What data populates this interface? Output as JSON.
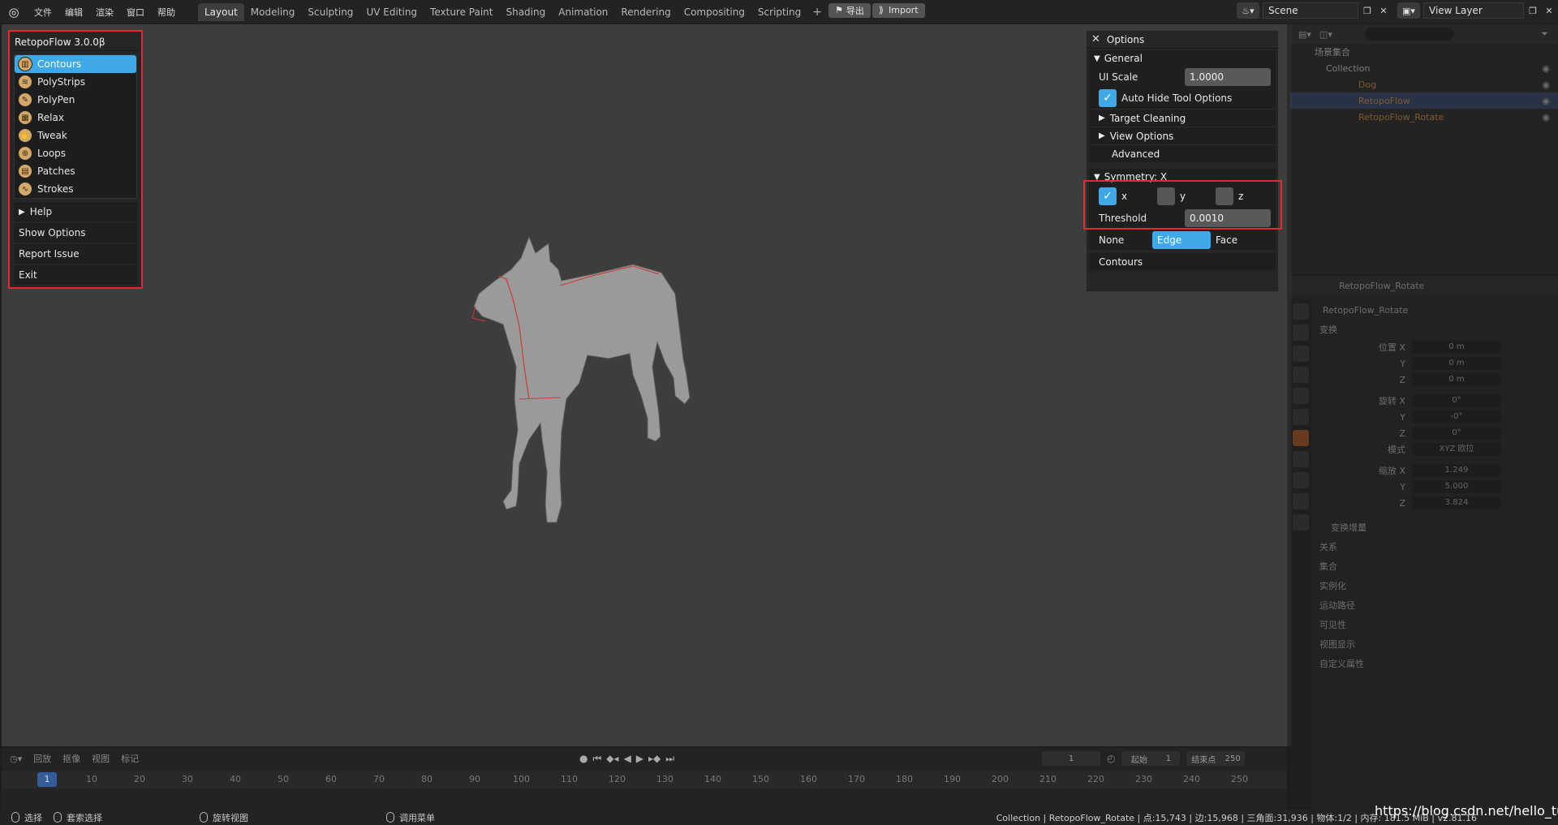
{
  "topbar": {
    "menus": [
      "文件",
      "编辑",
      "渲染",
      "窗口",
      "帮助"
    ],
    "workspaces": [
      "Layout",
      "Modeling",
      "Sculpting",
      "UV Editing",
      "Texture Paint",
      "Shading",
      "Animation",
      "Rendering",
      "Compositing",
      "Scripting"
    ],
    "active_workspace": "Layout",
    "add_tab": "+",
    "export_label": "导出",
    "import_label": "Import",
    "scene_name": "Scene",
    "view_layer": "View Layer"
  },
  "retopoflow": {
    "title": "RetopoFlow 3.0.0β",
    "tools": [
      {
        "label": "Contours",
        "icon": "contours-icon",
        "active": true
      },
      {
        "label": "PolyStrips",
        "icon": "polystrips-icon",
        "active": false
      },
      {
        "label": "PolyPen",
        "icon": "polypen-icon",
        "active": false
      },
      {
        "label": "Relax",
        "icon": "relax-icon",
        "active": false
      },
      {
        "label": "Tweak",
        "icon": "tweak-icon",
        "active": false
      },
      {
        "label": "Loops",
        "icon": "loops-icon",
        "active": false
      },
      {
        "label": "Patches",
        "icon": "patches-icon",
        "active": false
      },
      {
        "label": "Strokes",
        "icon": "strokes-icon",
        "active": false
      }
    ],
    "help": "Help",
    "show_options": "Show Options",
    "report_issue": "Report Issue",
    "exit": "Exit"
  },
  "options": {
    "title": "Options",
    "general": "General",
    "ui_scale_label": "UI Scale",
    "ui_scale_value": "1.0000",
    "auto_hide_label": "Auto Hide Tool Options",
    "target_cleaning": "Target Cleaning",
    "view_options": "View Options",
    "advanced": "Advanced",
    "symmetry_title": "Symmetry: X",
    "sym_x": "x",
    "sym_y": "y",
    "sym_z": "z",
    "threshold_label": "Threshold",
    "threshold_value": "0.0010",
    "mode_none": "None",
    "mode_edge": "Edge",
    "mode_face": "Face",
    "contours_section": "Contours"
  },
  "outliner": {
    "root": "场景集合",
    "collection": "Collection",
    "items": [
      "Dog",
      "RetopoFlow",
      "RetopoFlow_Rotate"
    ]
  },
  "properties": {
    "object_name": "RetopoFlow_Rotate",
    "transform": "变换",
    "loc_label": "位置 X",
    "loc_values": [
      "0 m",
      "0 m",
      "0 m"
    ],
    "rot_label": "旋转 X",
    "rot_values": [
      "0°",
      "-0°",
      "0°"
    ],
    "mode_label": "模式",
    "mode_value": "XYZ 欧拉",
    "scale_label": "缩放 X",
    "scale_values": [
      "1.249",
      "5.000",
      "3.824"
    ],
    "delta": "变换增量",
    "sections": [
      "关系",
      "集合",
      "实例化",
      "运动路径",
      "可见性",
      "视图显示",
      "自定义属性"
    ]
  },
  "timeline": {
    "menus": [
      "回放",
      "抠像",
      "视图",
      "标记"
    ],
    "current_frame": "1",
    "start_label": "起始",
    "start_value": "1",
    "end_label": "结束点",
    "end_value": "250",
    "ruler": [
      "1",
      "10",
      "20",
      "30",
      "40",
      "50",
      "60",
      "70",
      "80",
      "90",
      "100",
      "110",
      "120",
      "130",
      "140",
      "150",
      "160",
      "170",
      "180",
      "190",
      "200",
      "210",
      "220",
      "230",
      "240",
      "250"
    ]
  },
  "statusbar": {
    "select": "选择",
    "box_select": "套索选择",
    "rotate_view": "旋转视图",
    "call_menu": "调用菜单",
    "stats": "Collection | RetopoFlow_Rotate | 点:15,743 | 边:15,968 | 三角面:31,936 | 物体:1/2 | 内存: 181.5 MiB | v2.81.16",
    "watermark": "https://blog.csdn.net/hello_tute"
  },
  "colors": {
    "accent": "#3fa8e6",
    "highlight_border": "#e02c2c",
    "viewport_bg": "#3d3d3d"
  }
}
